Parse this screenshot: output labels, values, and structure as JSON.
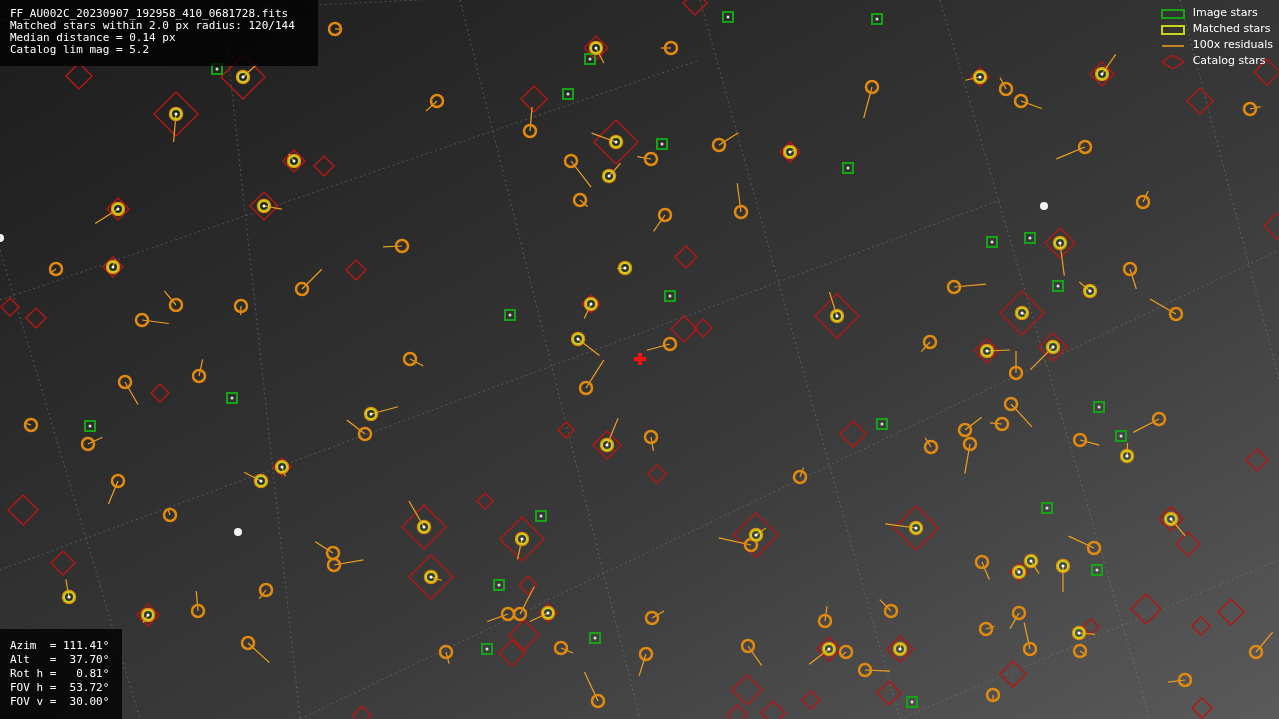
{
  "info_panel": {
    "lines": [
      "FF_AU002C_20230907_192958_410_0681728.fits",
      "Matched stars within 2.0 px radius: 120/144",
      "Median distance = 0.14 px",
      "Catalog lim mag = 5.2"
    ]
  },
  "pointing_panel": {
    "lines": [
      "Azim  = 111.41°",
      "Alt   =  37.70°",
      "Rot h =   0.81°",
      "FOV h =  53.72°",
      "FOV v =  30.00°"
    ]
  },
  "legend": [
    {
      "kind": "image",
      "label": "Image stars"
    },
    {
      "kind": "matched",
      "label": "Matched stars"
    },
    {
      "kind": "residual",
      "label": "100x residuals"
    },
    {
      "kind": "catalog",
      "label": "Catalog stars"
    }
  ]
}
